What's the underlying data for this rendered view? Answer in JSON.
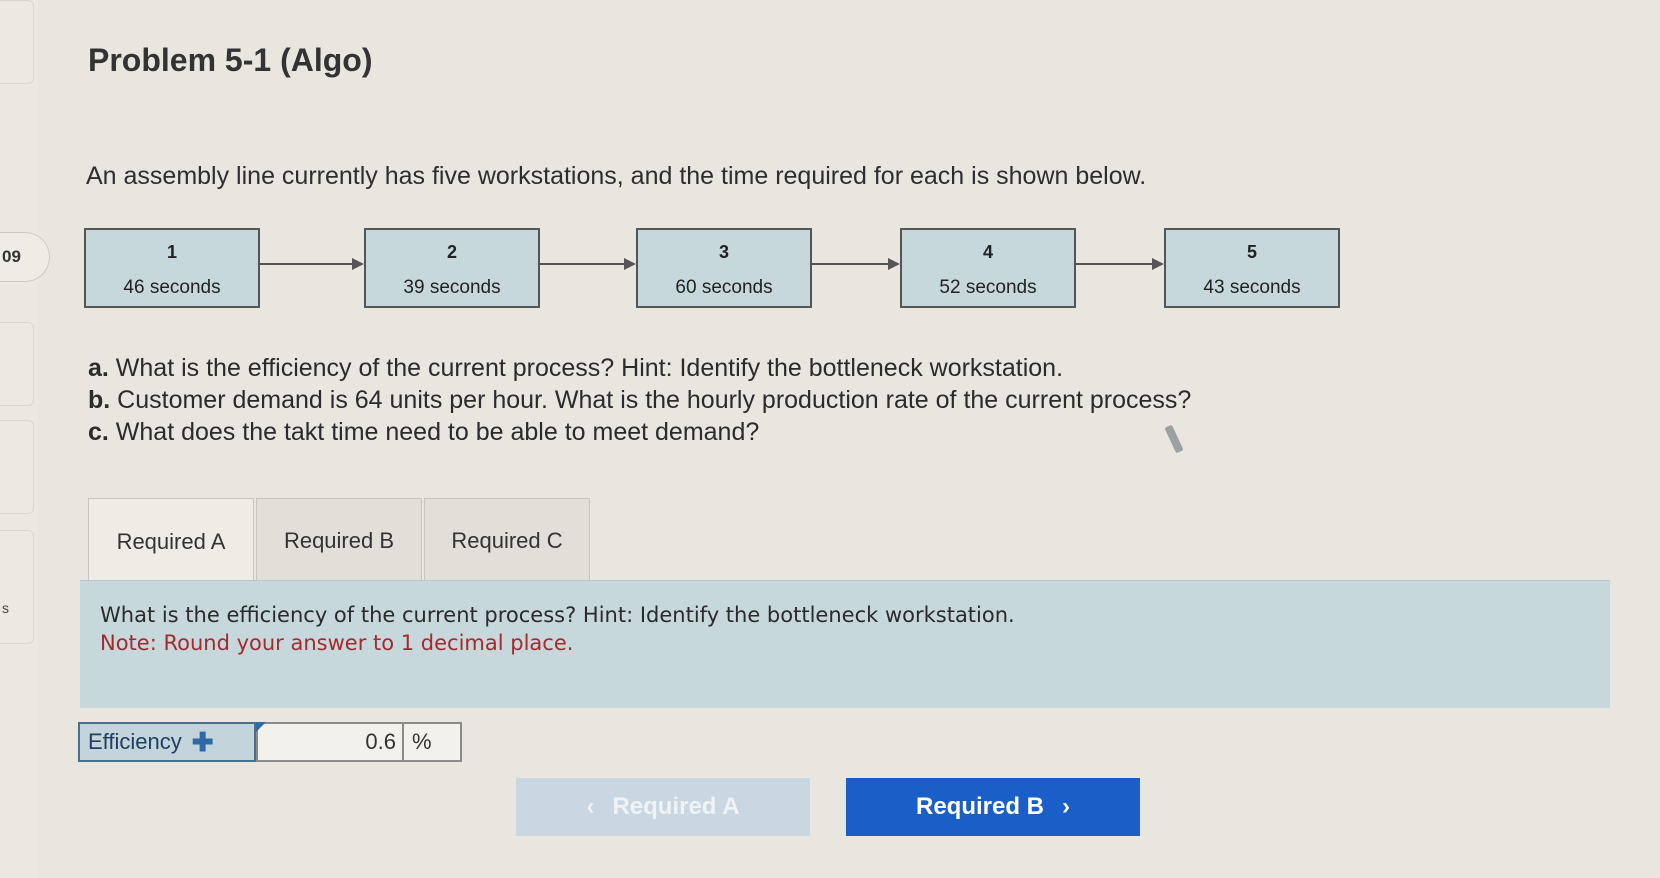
{
  "sidebar": {
    "number": "09",
    "letter": "s"
  },
  "title": "Problem 5-1 (Algo)",
  "intro": "An assembly line currently has five workstations, and the time required for each is shown below.",
  "workstations": [
    {
      "num": "1",
      "time": "46 seconds"
    },
    {
      "num": "2",
      "time": "39 seconds"
    },
    {
      "num": "3",
      "time": "60 seconds"
    },
    {
      "num": "4",
      "time": "52 seconds"
    },
    {
      "num": "5",
      "time": "43 seconds"
    }
  ],
  "questions": {
    "a_prefix": "a.",
    "a_text": " What is the efficiency of the current process? Hint: Identify the bottleneck workstation.",
    "b_prefix": "b.",
    "b_text": " Customer demand is 64 units per hour. What is the hourly production rate of the current process?",
    "c_prefix": "c.",
    "c_text": " What does the takt time need to be able to meet demand?"
  },
  "tabs": [
    "Required A",
    "Required B",
    "Required C"
  ],
  "prompt": {
    "question": "What is the efficiency of the current process? Hint: Identify the bottleneck workstation.",
    "note": "Note: Round your answer to 1 decimal place."
  },
  "answer": {
    "label": "Efficiency",
    "value": "0.6",
    "unit": "%"
  },
  "nav": {
    "prev_label": "Required A",
    "prev_icon": "‹",
    "next_label": "Required B",
    "next_icon": "›"
  },
  "colors": {
    "accent": "#1a5fc7",
    "box_fill": "#c7d8dd",
    "note": "#a52a2a"
  }
}
